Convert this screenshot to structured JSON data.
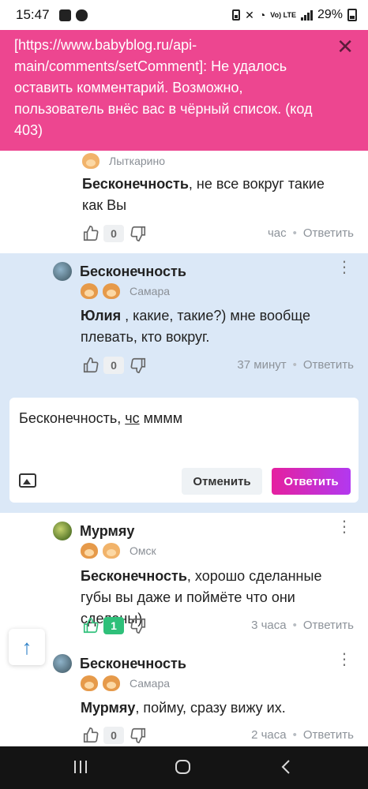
{
  "status_bar": {
    "time": "15:47",
    "battery": "29%",
    "network": "Vo) LTE"
  },
  "banner": {
    "message": "[https://www.babyblog.ru/api-main/comments/setComment]: Не удалось оставить комментарий. Возможно, пользователь внёс вас в чёрный список. (код 403)",
    "close": "✕"
  },
  "comments": [
    {
      "location": "Лыткарино",
      "mention": "Бесконечность",
      "text": ", не все вокруг такие как Вы",
      "likes": "0",
      "time": "час",
      "reply_label": "Ответить"
    },
    {
      "author": "Бесконечность",
      "location": "Самара",
      "mention": "Юлия",
      "text": " , какие, такие?) мне вообще плевать, кто вокруг.",
      "likes": "0",
      "time": "37 минут",
      "reply_label": "Ответить"
    },
    {
      "author": "Мурмяу",
      "location": "Омск",
      "mention": "Бесконечность",
      "text": ", хорошо сделанные губы вы даже и поймёте что они сделаны)",
      "likes": "1",
      "time": "3 часа",
      "reply_label": "Ответить"
    },
    {
      "author": "Бесконечность",
      "location": "Самара",
      "mention": "Мурмяу",
      "text": ", пойму, сразу вижу их.",
      "likes": "0",
      "time": "2 часа",
      "reply_label": "Ответить"
    }
  ],
  "reply_box": {
    "mention": "Бесконечность",
    "sep": ", ",
    "underlined": "чс",
    "rest": " мммм",
    "cancel_label": "Отменить",
    "submit_label": "Ответить"
  },
  "scroll_top": "↑",
  "icons": [
    "like-icon",
    "dislike-icon",
    "image-icon",
    "arrow-up-icon",
    "close-icon",
    "more-icon"
  ],
  "colors": {
    "banner": "#ed4690",
    "highlight": "#dbe8f7",
    "accent_gradient_start": "#e5209f",
    "accent_gradient_end": "#b239f0",
    "like_active": "#2fc07a"
  }
}
